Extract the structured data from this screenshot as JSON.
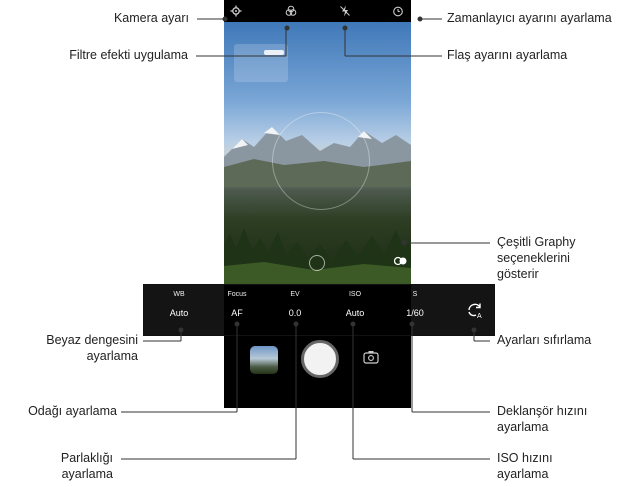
{
  "callouts": {
    "camera_settings": "Kamera ayarı",
    "filter_effect": "Filtre efekti uygulama",
    "timer": "Zamanlayıcı ayarını ayarlama",
    "flash": "Flaş ayarını ayarlama",
    "graphy_line1": "Çeşitli Graphy",
    "graphy_line2": "seçeneklerini",
    "graphy_line3": "gösterir",
    "wb_line1": "Beyaz dengesini",
    "wb_line2": "ayarlama",
    "reset": "Ayarları sıfırlama",
    "focus": "Odağı ayarlama",
    "shutter_line1": "Deklanşör hızını",
    "shutter_line2": "ayarlama",
    "brightness_line1": "Parlaklığı",
    "brightness_line2": "ayarlama",
    "iso_line1": "ISO hızını",
    "iso_line2": "ayarlama"
  },
  "manual_controls": {
    "wb": {
      "label": "WB",
      "value": "Auto"
    },
    "focus": {
      "label": "Focus",
      "value": "AF"
    },
    "ev": {
      "label": "EV",
      "value": "0.0"
    },
    "iso": {
      "label": "ISO",
      "value": "Auto"
    },
    "shutter": {
      "label": "S",
      "value": "1/60"
    }
  },
  "icons": {
    "settings": "gear-icon",
    "filter": "filter-icon",
    "flash": "flash-off-icon",
    "timer": "timer-icon",
    "graphy": "graphy-icon",
    "reset": "reset-auto-icon",
    "switch_camera": "switch-camera-icon"
  },
  "colors": {
    "background": "#ffffff",
    "phone": "#000000",
    "text": "#222222",
    "lines": "#333333"
  }
}
